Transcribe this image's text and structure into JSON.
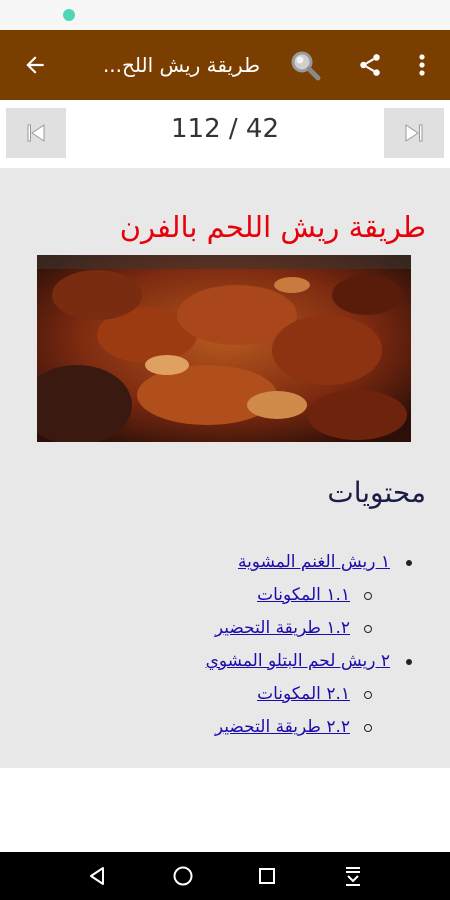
{
  "app_bar": {
    "title": "طريقة ريش اللح..."
  },
  "pager": {
    "page_indicator": "112 / 42"
  },
  "article": {
    "title": "طريقة ريش اللحم بالفرن"
  },
  "toc": {
    "heading": "محتويات",
    "items": [
      {
        "label": "١ ريش الغنم المشوية"
      },
      {
        "label": "١.١ المكونات"
      },
      {
        "label": "١.٢ طريقة التحضير"
      },
      {
        "label": "٢ ريش لحم البتلو المشوي"
      },
      {
        "label": "٢.١ المكونات"
      },
      {
        "label": "٢.٢ طريقة التحضير"
      }
    ]
  },
  "colors": {
    "app_bar": "#7a3e00",
    "title_red": "#e8000b",
    "link_blue": "#1a0dab"
  }
}
